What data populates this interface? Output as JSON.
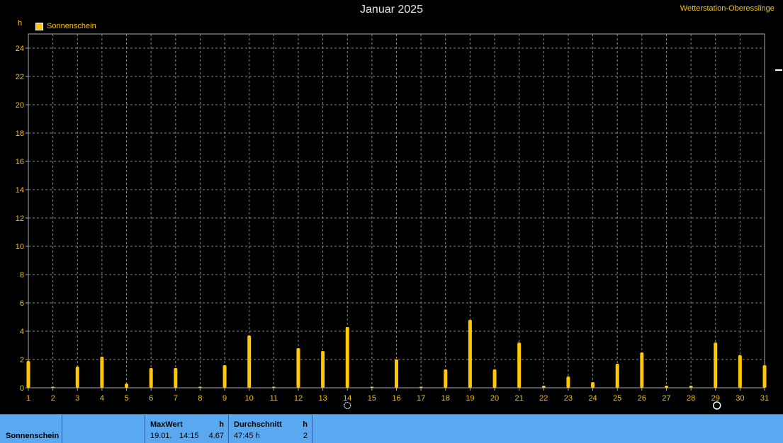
{
  "title": "Januar 2025",
  "station": "Wetterstation-Oberesslingen",
  "legend": {
    "label": "Sonnenschein",
    "color": "#ffc800"
  },
  "unit": "h",
  "chart_data": {
    "type": "bar",
    "title": "Januar 2025",
    "ylabel": "h",
    "ylim": [
      0,
      25
    ],
    "yticks": [
      0,
      2,
      4,
      6,
      8,
      10,
      12,
      14,
      16,
      18,
      20,
      22,
      24
    ],
    "grid": true,
    "legend_position": "top-left",
    "categories": [
      "1",
      "2",
      "3",
      "4",
      "5",
      "6",
      "7",
      "8",
      "9",
      "10",
      "11",
      "12",
      "13",
      "14",
      "15",
      "16",
      "17",
      "18",
      "19",
      "20",
      "21",
      "22",
      "23",
      "24",
      "25",
      "26",
      "27",
      "28",
      "29",
      "30",
      "31"
    ],
    "series": [
      {
        "name": "Sonnenschein",
        "color": "#ffc800",
        "values": [
          1.9,
          0.05,
          1.5,
          2.2,
          0.3,
          1.4,
          1.4,
          0.05,
          1.6,
          3.7,
          0.05,
          2.8,
          2.6,
          4.3,
          0.05,
          2.0,
          0.05,
          1.3,
          4.8,
          1.3,
          3.2,
          0.15,
          0.8,
          0.4,
          1.7,
          2.5,
          0.15,
          0.15,
          3.2,
          2.3,
          1.6
        ]
      }
    ],
    "moon_markers": [
      {
        "day": "14",
        "symbol": "full-moon"
      },
      {
        "day": "29",
        "symbol": "new-moon"
      }
    ]
  },
  "summary": {
    "row_label": "Sonnenschein",
    "maxwert": {
      "header": "MaxWert",
      "unit": "h",
      "date": "19.01.",
      "time": "14:15",
      "value": "4.67"
    },
    "durchschnitt": {
      "header": "Durchschnitt",
      "unit": "h",
      "total": "47:45 h",
      "value": "2"
    }
  }
}
